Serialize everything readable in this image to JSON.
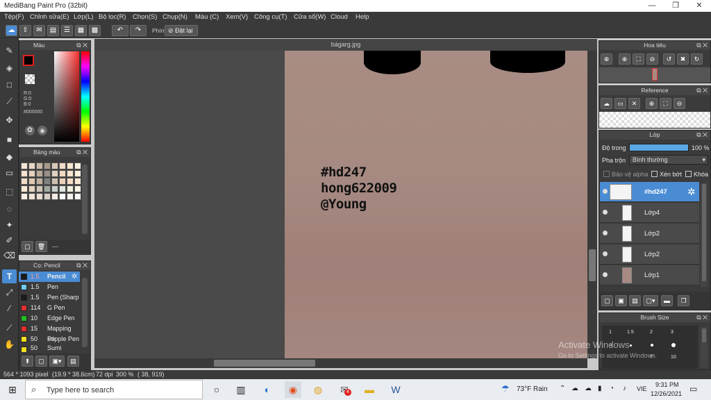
{
  "window": {
    "title": "MediBang Paint Pro (32bit)"
  },
  "menu": [
    "Tệp(F)",
    "Chỉnh sửa(E)",
    "Lớp(L)",
    "Bộ lọc(R)",
    "Chọn(S)",
    "Chụp(N)",
    "Màu (C)",
    "Xem(V)",
    "Công cụ(T)",
    "Cửa sổ(W)",
    "Cloud",
    "Help"
  ],
  "toolbar": {
    "key_label": "Phím",
    "reset_label": "Đặt lại"
  },
  "color_panel": {
    "title": "Màu",
    "r": "R:0",
    "g": "G:0",
    "b": "B:0",
    "hex": "#000000"
  },
  "palette_panel": {
    "title": "Bảng màu",
    "footer": "---"
  },
  "brush_panel": {
    "title": "Cọ: Pencil",
    "items": [
      {
        "size": "1.5",
        "name": "Pencil",
        "color": "#1a1a1a"
      },
      {
        "size": "1.5",
        "name": "Pen",
        "color": "#6ecbf2"
      },
      {
        "size": "1.5",
        "name": "Pen (Sharp",
        "color": "#1a1a1a"
      },
      {
        "size": "114",
        "name": "G Pen",
        "color": "#e03030"
      },
      {
        "size": "10",
        "name": "Edge Pen",
        "color": "#22bb22"
      },
      {
        "size": "15",
        "name": "Mapping Pe",
        "color": "#e03030"
      },
      {
        "size": "50",
        "name": "Stipple Pen",
        "color": "#f0e020"
      },
      {
        "size": "50",
        "name": "Sumi",
        "color": "#f0e020"
      }
    ]
  },
  "document": {
    "tab": "bágarg.jpg",
    "lines": [
      "#hd247",
      "hong622009",
      "@Young"
    ]
  },
  "navigator_panel": {
    "title": "Hoa tiêu"
  },
  "reference_panel": {
    "title": "Reference"
  },
  "layer_panel": {
    "title": "Lớp",
    "opacity_label": "Độ trong",
    "opacity_value": "100 %",
    "opacity": 1.0,
    "blend_label": "Pha trộn",
    "blend_value": "Bình thường",
    "protect_alpha": "Bảo vệ alpha",
    "clipping": "Xén bớt",
    "lock": "Khóa",
    "layers": [
      {
        "name": "#hd247",
        "selected": true
      },
      {
        "name": "Lớp4",
        "selected": false
      },
      {
        "name": "Lớp2",
        "selected": false
      },
      {
        "name": "Lớp2",
        "selected": false
      },
      {
        "name": "Lớp1",
        "selected": false
      }
    ]
  },
  "brush_size_panel": {
    "title": "Brush Size",
    "sizes": [
      "1",
      "1.5",
      "2",
      "3"
    ],
    "row2": [
      "7",
      "10"
    ]
  },
  "watermark": {
    "line1": "Activate Windows",
    "line2": "Go to Settings to activate Windows."
  },
  "status": {
    "size": "564 * 1093 pixel",
    "cm": "(19.9 * 38.6cm)",
    "dpi": "72 dpi",
    "zoom": "300 %",
    "coords": "( 38, 919)"
  },
  "taskbar": {
    "search_placeholder": "Type here to search",
    "weather": "73°F  Rain",
    "lang": "VIE",
    "time": "9:31 PM",
    "date": "12/26/2021",
    "badge": "4"
  }
}
